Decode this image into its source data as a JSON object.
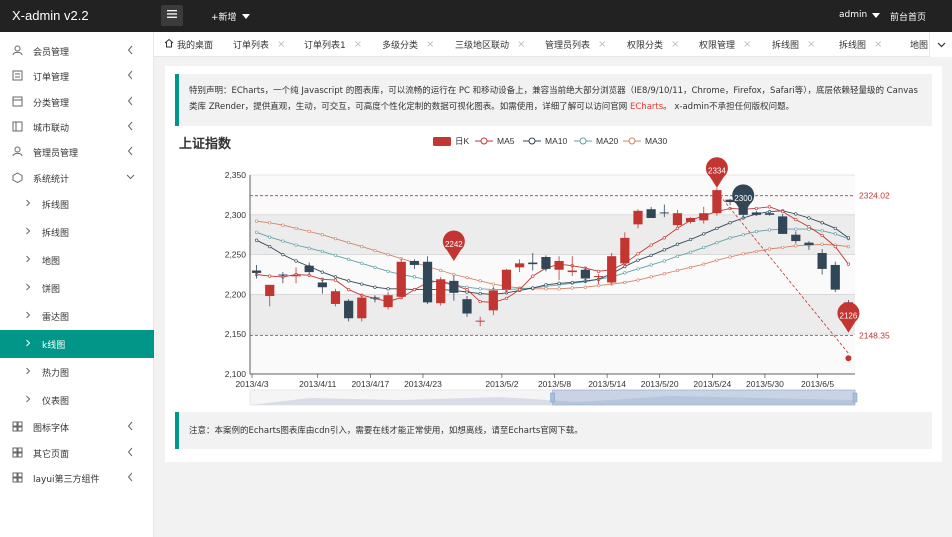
{
  "topbar": {
    "logo": "X-admin v2.2",
    "add_label": "+新增",
    "user_label": "admin",
    "home_label": "前台首页"
  },
  "sidebar": {
    "items": [
      {
        "label": "会员管理",
        "icon": "user-icon"
      },
      {
        "label": "订单管理",
        "icon": "order-icon"
      },
      {
        "label": "分类管理",
        "icon": "category-icon"
      },
      {
        "label": "城市联动",
        "icon": "city-icon"
      },
      {
        "label": "管理员管理",
        "icon": "admin-icon"
      },
      {
        "label": "系统统计",
        "icon": "stats-icon"
      }
    ],
    "sub_items": [
      "拆线图",
      "拆线图",
      "地图",
      "饼图",
      "雷达图",
      "k线图",
      "热力图",
      "仪表图"
    ],
    "active_sub": "k线图",
    "bottom_items": [
      {
        "label": "图标字体",
        "icon": "font-icon"
      },
      {
        "label": "其它页面",
        "icon": "pages-icon"
      },
      {
        "label": "layui第三方组件",
        "icon": "plugin-icon"
      }
    ]
  },
  "tabs": [
    "我的桌面",
    "订单列表",
    "订单列表1",
    "多级分类",
    "三级地区联动",
    "管理员列表",
    "权限分类",
    "权限管理",
    "拆线图",
    "拆线图",
    "地图"
  ],
  "notice": {
    "text": "特别声明：ECharts，一个纯 Javascript 的图表库，可以流畅的运行在 PC 和移动设备上，兼容当前绝大部分浏览器（IE8/9/10/11，Chrome，Firefox，Safari等），底层依赖轻量级的 Canvas 类库 ZRender，提供直观，生动，可交互，可高度个性化定制的数据可视化图表。如需使用，详细了解可以访问官网",
    "link": "ECharts",
    "suffix": "。 x-admin不承担任何版权问题。"
  },
  "footer_note": "注意：本案例的Echarts图表库由cdn引入，需要在线才能正常使用，如想离线，请至Echarts官网下载。",
  "colors": {
    "up": "#c23531",
    "down": "#314656",
    "ma5": "#c23531",
    "ma10": "#2f4554",
    "ma20": "#61a0a8",
    "ma30": "#d48265",
    "accent": "#009688"
  },
  "chart_data": {
    "type": "candlestick",
    "title": "上证指数",
    "legend": [
      "日K",
      "MA5",
      "MA10",
      "MA20",
      "MA30"
    ],
    "legend_position": "top-center",
    "x_ticks": [
      "2013/4/3",
      "2013/4/11",
      "2013/4/17",
      "2013/4/23",
      "2013/5/2",
      "2013/5/8",
      "2013/5/14",
      "2013/5/20",
      "2013/5/24",
      "2013/5/30",
      "2013/6/5"
    ],
    "ylim": [
      2100,
      2350
    ],
    "y_ticks": [
      "2,100",
      "2,150",
      "2,200",
      "2,250",
      "2,300",
      "2,350"
    ],
    "candles": [
      [
        2230,
        2227,
        2220,
        2237
      ],
      [
        2198,
        2212,
        2185,
        2212
      ],
      [
        2225,
        2224,
        2214,
        2228
      ],
      [
        2224,
        2224,
        2214,
        2234
      ],
      [
        2236,
        2228,
        2224,
        2240
      ],
      [
        2215,
        2209,
        2201,
        2220
      ],
      [
        2188,
        2204,
        2185,
        2207
      ],
      [
        2192,
        2170,
        2166,
        2194
      ],
      [
        2170,
        2196,
        2166,
        2201
      ],
      [
        2196,
        2195,
        2190,
        2199
      ],
      [
        2184,
        2199,
        2181,
        2203
      ],
      [
        2197,
        2241,
        2195,
        2245
      ],
      [
        2242,
        2237,
        2232,
        2244
      ],
      [
        2241,
        2190,
        2188,
        2248
      ],
      [
        2189,
        2219,
        2186,
        2222
      ],
      [
        2217,
        2202,
        2192,
        2224
      ],
      [
        2194,
        2176,
        2172,
        2198
      ],
      [
        2166,
        2167,
        2160,
        2172
      ],
      [
        2180,
        2205,
        2174,
        2210
      ],
      [
        2206,
        2231,
        2202,
        2232
      ],
      [
        2234,
        2239,
        2228,
        2244
      ],
      [
        2240,
        2238,
        2230,
        2252
      ],
      [
        2247,
        2232,
        2229,
        2249
      ],
      [
        2231,
        2242,
        2218,
        2248
      ],
      [
        2228,
        2230,
        2223,
        2248
      ],
      [
        2231,
        2220,
        2215,
        2234
      ],
      [
        2222,
        2223,
        2213,
        2226
      ],
      [
        2215,
        2248,
        2212,
        2252
      ],
      [
        2239,
        2271,
        2236,
        2278
      ],
      [
        2288,
        2305,
        2283,
        2307
      ],
      [
        2307,
        2296,
        2296,
        2310
      ],
      [
        2303,
        2302,
        2297,
        2313
      ],
      [
        2287,
        2302,
        2285,
        2306
      ],
      [
        2291,
        2296,
        2289,
        2297
      ],
      [
        2293,
        2302,
        2289,
        2310
      ],
      [
        2302,
        2331,
        2299,
        2334
      ],
      [
        2319,
        2316,
        2312,
        2320
      ],
      [
        2316,
        2300,
        2295,
        2321
      ],
      [
        2303,
        2300,
        2300,
        2305
      ],
      [
        2302,
        2300,
        2299,
        2303
      ],
      [
        2298,
        2276,
        2276,
        2301
      ],
      [
        2275,
        2267,
        2264,
        2279
      ],
      [
        2265,
        2262,
        2256,
        2267
      ],
      [
        2252,
        2232,
        2225,
        2257
      ],
      [
        2237,
        2206,
        2203,
        2241
      ],
      [
        2190,
        2163,
        2154,
        2193
      ]
    ],
    "ma5": [
      2225,
      2223,
      2222,
      2225,
      2224,
      2219,
      2218,
      2206,
      2199,
      2195,
      2191,
      2196,
      2206,
      2215,
      2217,
      2212,
      2206,
      2191,
      2190,
      2195,
      2206,
      2223,
      2233,
      2238,
      2236,
      2233,
      2229,
      2231,
      2239,
      2251,
      2262,
      2271,
      2283,
      2293,
      2299,
      2304,
      2308,
      2307,
      2308,
      2310,
      2304,
      2294,
      2285,
      2274,
      2260,
      2238
    ],
    "ma10": [
      2268,
      2260,
      2250,
      2242,
      2235,
      2228,
      2222,
      2217,
      2213,
      2209,
      2207,
      2207,
      2206,
      2206,
      2206,
      2205,
      2203,
      2201,
      2200,
      2202,
      2205,
      2208,
      2212,
      2214,
      2215,
      2217,
      2219,
      2226,
      2235,
      2243,
      2249,
      2256,
      2263,
      2269,
      2276,
      2283,
      2290,
      2296,
      2301,
      2304,
      2305,
      2301,
      2296,
      2290,
      2283,
      2271
    ],
    "ma20": [
      2278,
      2272,
      2267,
      2262,
      2258,
      2254,
      2249,
      2244,
      2239,
      2234,
      2229,
      2225,
      2222,
      2218,
      2215,
      2212,
      2209,
      2207,
      2206,
      2206,
      2207,
      2208,
      2210,
      2212,
      2214,
      2216,
      2219,
      2222,
      2227,
      2232,
      2237,
      2242,
      2248,
      2253,
      2259,
      2265,
      2271,
      2275,
      2279,
      2281,
      2282,
      2282,
      2282,
      2280,
      2276,
      2270
    ],
    "ma30": [
      2292,
      2290,
      2287,
      2283,
      2279,
      2275,
      2270,
      2265,
      2260,
      2255,
      2250,
      2245,
      2240,
      2235,
      2230,
      2225,
      2221,
      2217,
      2213,
      2210,
      2208,
      2207,
      2207,
      2207,
      2208,
      2209,
      2211,
      2213,
      2215,
      2218,
      2222,
      2226,
      2230,
      2234,
      2238,
      2243,
      2247,
      2251,
      2254,
      2257,
      2259,
      2261,
      2262,
      2263,
      2262,
      2260
    ],
    "mark_points": [
      {
        "label": "2242",
        "value": 2242,
        "index": 15,
        "type": "max-up"
      },
      {
        "label": "2334",
        "value": 2334,
        "index": 35,
        "type": "highest"
      },
      {
        "label": "2300",
        "value": 2300,
        "index": 37,
        "type": "max-down"
      },
      {
        "label": "2126",
        "value": 2126,
        "index": 45,
        "type": "lowest"
      }
    ],
    "mark_lines": [
      {
        "label": "2324.02",
        "value": 2324.02
      },
      {
        "label": "2148.35",
        "value": 2148.35
      }
    ],
    "datazoom_range": [
      "50%",
      "100%"
    ]
  }
}
